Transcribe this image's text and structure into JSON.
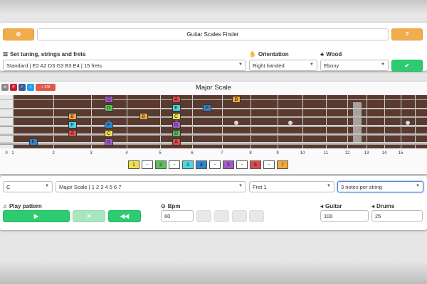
{
  "app": {
    "title": "Guitar Scales Finder"
  },
  "labels": {
    "tuning": "Set tuning, strings and frets",
    "orientation": "Orientation",
    "wood": "Wood",
    "play_pattern": "Play pattern",
    "bpm": "Bpm",
    "guitar": "Guitar",
    "drums": "Drums"
  },
  "selects": {
    "tuning": "Standard | E2 A2 D3 G3 B3 E4 | 15 frets",
    "orientation": "Right handed",
    "wood": "Ebony",
    "key": "C",
    "scale": "Major Scale | 1 2 3 4 5 6 7",
    "fret": "Fret 1",
    "pattern": "3 notes per string"
  },
  "inputs": {
    "bpm": "60",
    "guitar": "100",
    "drums": "25"
  },
  "scale_title": "Major Scale",
  "share": {
    "count": "+ 178"
  },
  "fret_numbers": [
    "0",
    "1",
    "2",
    "3",
    "4",
    "5",
    "6",
    "7",
    "8",
    "9",
    "10",
    "11",
    "12",
    "13",
    "14",
    "15"
  ],
  "degrees": [
    "1",
    "-",
    "2",
    "-",
    "3",
    "4",
    "-",
    "5",
    "-",
    "6",
    "-",
    "7"
  ],
  "colors": {
    "1": "#f1e04b",
    "2": "#5fbf5a",
    "3": "#4dd6e6",
    "4": "#2f86d0",
    "5": "#a35cc9",
    "6": "#e24a4a",
    "7": "#f4a83a",
    "blank": "#ffffff"
  },
  "notes": [
    {
      "label": "F",
      "string": 6,
      "fret": 1
    },
    {
      "label": "A",
      "string": 5,
      "fret": 2
    },
    {
      "label": "E",
      "string": 4,
      "fret": 2
    },
    {
      "label": "B",
      "string": 3,
      "fret": 2
    },
    {
      "label": "G",
      "string": 1,
      "fret": 3
    },
    {
      "label": "D",
      "string": 2,
      "fret": 3
    },
    {
      "label": "F",
      "string": 4,
      "fret": 3
    },
    {
      "label": "C",
      "string": 5,
      "fret": 3
    },
    {
      "label": "G",
      "string": 6,
      "fret": 3
    },
    {
      "label": "B",
      "string": 3,
      "fret": 4
    },
    {
      "label": "A",
      "string": 1,
      "fret": 5
    },
    {
      "label": "E",
      "string": 2,
      "fret": 5
    },
    {
      "label": "C",
      "string": 3,
      "fret": 5
    },
    {
      "label": "G",
      "string": 4,
      "fret": 5
    },
    {
      "label": "D",
      "string": 5,
      "fret": 5
    },
    {
      "label": "A",
      "string": 6,
      "fret": 5
    },
    {
      "label": "F",
      "string": 2,
      "fret": 6
    },
    {
      "label": "B",
      "string": 1,
      "fret": 7
    }
  ],
  "note_degrees": {
    "C": "1",
    "D": "2",
    "E": "3",
    "F": "4",
    "G": "5",
    "A": "6",
    "B": "7"
  }
}
